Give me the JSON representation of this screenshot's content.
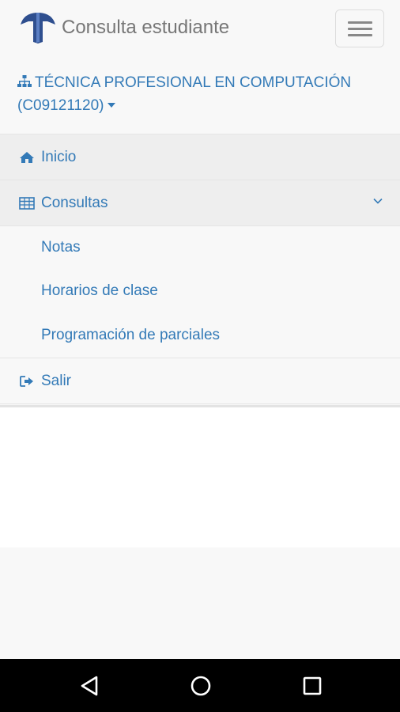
{
  "app": {
    "title": "Consulta estudiante"
  },
  "program": {
    "name": "TÉCNICA PROFESIONAL EN COMPUTACIÓN",
    "code": "(C09121120)"
  },
  "menu": {
    "inicio": "Inicio",
    "consultas": "Consultas",
    "submenu": [
      "Notas",
      "Horarios de clase",
      "Programación de parciales"
    ],
    "salir": "Salir"
  },
  "colors": {
    "link": "#337ab7",
    "navbar_bg": "#f8f8f8",
    "active_bg": "#eeeeee",
    "logo": "#2f4f8f"
  },
  "icons": {
    "program": "sitemap-icon",
    "inicio": "home-icon",
    "consultas": "table-icon",
    "salir": "sign-out-icon",
    "expand": "chevron-down-icon",
    "menu": "hamburger-menu-icon"
  }
}
